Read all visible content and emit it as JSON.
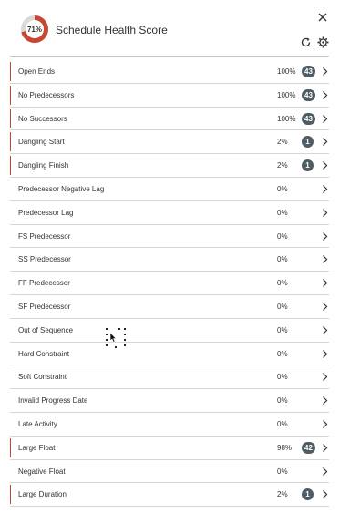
{
  "header": {
    "score": 0.71,
    "score_label": "71%",
    "title": "Schedule Health Score",
    "colors": {
      "ring_fill": "#c74634",
      "ring_track": "#d9d9d9"
    }
  },
  "rows": [
    {
      "label": "Open Ends",
      "pct": "100%",
      "count": "43",
      "flagged": true
    },
    {
      "label": "No Predecessors",
      "pct": "100%",
      "count": "43",
      "flagged": true
    },
    {
      "label": "No Successors",
      "pct": "100%",
      "count": "43",
      "flagged": true
    },
    {
      "label": "Dangling Start",
      "pct": "2%",
      "count": "1",
      "flagged": true
    },
    {
      "label": "Dangling Finish",
      "pct": "2%",
      "count": "1",
      "flagged": true
    },
    {
      "label": "Predecessor Negative Lag",
      "pct": "0%",
      "count": "",
      "flagged": false
    },
    {
      "label": "Predecessor Lag",
      "pct": "0%",
      "count": "",
      "flagged": false
    },
    {
      "label": "FS Predecessor",
      "pct": "0%",
      "count": "",
      "flagged": false
    },
    {
      "label": "SS Predecessor",
      "pct": "0%",
      "count": "",
      "flagged": false
    },
    {
      "label": "FF Predecessor",
      "pct": "0%",
      "count": "",
      "flagged": false
    },
    {
      "label": "SF Predecessor",
      "pct": "0%",
      "count": "",
      "flagged": false
    },
    {
      "label": "Out of Sequence",
      "pct": "0%",
      "count": "",
      "flagged": false
    },
    {
      "label": "Hard Constraint",
      "pct": "0%",
      "count": "",
      "flagged": false
    },
    {
      "label": "Soft Constraint",
      "pct": "0%",
      "count": "",
      "flagged": false
    },
    {
      "label": "Invalid Progress Date",
      "pct": "0%",
      "count": "",
      "flagged": false
    },
    {
      "label": "Late Activity",
      "pct": "0%",
      "count": "",
      "flagged": false
    },
    {
      "label": "Large Float",
      "pct": "98%",
      "count": "42",
      "flagged": true
    },
    {
      "label": "Negative Float",
      "pct": "0%",
      "count": "",
      "flagged": false
    },
    {
      "label": "Large Duration",
      "pct": "2%",
      "count": "1",
      "flagged": true
    }
  ]
}
